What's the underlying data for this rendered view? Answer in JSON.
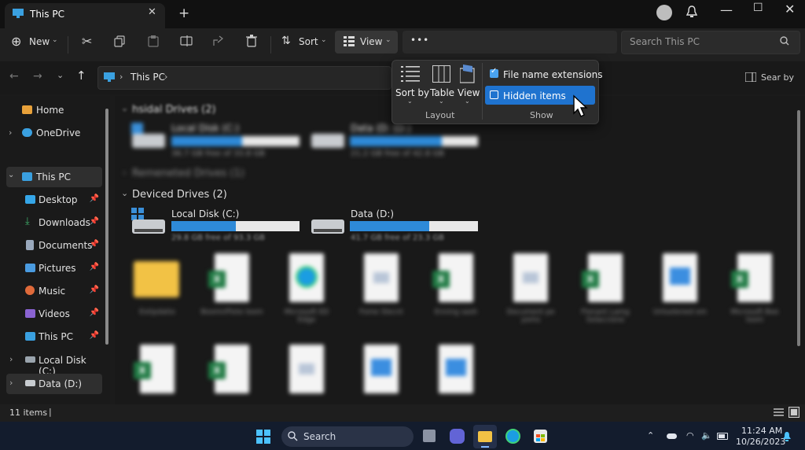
{
  "window": {
    "tab_title": "This PC",
    "close": "✕",
    "new_tab": "+",
    "minimize": "—",
    "maximize": "☐",
    "close_window": "✕"
  },
  "toolbar": {
    "new_label": "New",
    "sort_label": "Sort",
    "view_label": "View",
    "more_label": "•••",
    "search_placeholder": "Search This PC"
  },
  "address": {
    "location": "This PC",
    "right_label": "Sear by"
  },
  "sidebar": {
    "items": [
      {
        "label": "Home",
        "pinned": false
      },
      {
        "label": "OneDrive",
        "pinned": false
      },
      {
        "label": "This PC",
        "pinned": false
      },
      {
        "label": "Desktop",
        "pinned": true
      },
      {
        "label": "Downloads",
        "pinned": true
      },
      {
        "label": "Documents",
        "pinned": true
      },
      {
        "label": "Pictures",
        "pinned": true
      },
      {
        "label": "Music",
        "pinned": true
      },
      {
        "label": "Videos",
        "pinned": true
      },
      {
        "label": "This PC",
        "pinned": true
      },
      {
        "label": "Local Disk (C:)",
        "pinned": false
      },
      {
        "label": "Data (D:)",
        "pinned": false
      }
    ]
  },
  "groups": {
    "g1": {
      "title": "hsidal Drives (2)"
    },
    "g2": {
      "title": "Remeneted Drives (1)"
    },
    "g3": {
      "title": "Deviced Drives (2)"
    }
  },
  "drives": [
    {
      "name": "Local Disk (C:)",
      "free": "36.7 GB free of 33.8 GB",
      "used_fraction": 0.55
    },
    {
      "name": "Data (D: (D:)",
      "free": "21.2 GB free of 42.8 GB",
      "used_fraction": 0.72
    },
    {
      "name": "Local Disk (C:)",
      "free": "29.8 GB free of 93.3 GB",
      "used_fraction": 0.5
    },
    {
      "name": "Data (D:)",
      "free": "41.7 GB free of 23.3 GB",
      "used_fraction": 0.62
    }
  ],
  "files_row1": [
    {
      "caption": "Extipdatio",
      "kind": "folder"
    },
    {
      "caption": "BoomnPlote loom",
      "kind": "excel"
    },
    {
      "caption": "Microsoft ED Edge",
      "kind": "edge"
    },
    {
      "caption": "Fome Slecnt",
      "kind": "doc"
    },
    {
      "caption": "Enning sash",
      "kind": "excel"
    },
    {
      "caption": "Document pe yoms",
      "kind": "doc"
    },
    {
      "caption": "Flonant Lamg Solaccione",
      "kind": "excel"
    },
    {
      "caption": "Unluolened om",
      "kind": "image"
    },
    {
      "caption": "Microsoft Bee loom",
      "kind": "excel"
    }
  ],
  "files_row2": [
    {
      "kind": "excel"
    },
    {
      "kind": "excel"
    },
    {
      "kind": "doc"
    },
    {
      "kind": "image"
    },
    {
      "kind": "image"
    }
  ],
  "status": {
    "items": "11 items"
  },
  "taskbar": {
    "search": "Search",
    "time": "11:24 AM",
    "date": "10/26/2023"
  },
  "popup": {
    "sort_by": "Sort by",
    "table": "Table",
    "view": "View",
    "layout_caption": "Layout",
    "file_ext": "File name extensions",
    "file_ext_checked": true,
    "hidden_items": "Hidden items",
    "hidden_items_checked": false,
    "show_caption": "Show"
  },
  "colors": {
    "accent": "#1f73cf",
    "bar_fill": "#2e8ad8",
    "taskbar": "#131c2d"
  }
}
